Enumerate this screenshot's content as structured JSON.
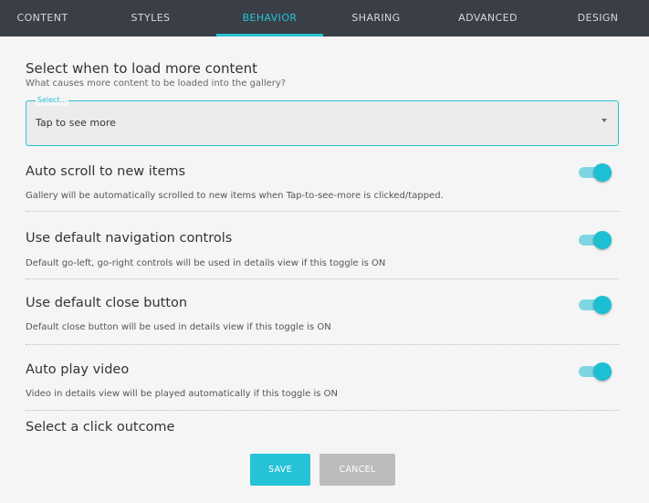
{
  "tabs": [
    {
      "label": "CONTENT",
      "active": false
    },
    {
      "label": "STYLES",
      "active": false
    },
    {
      "label": "BEHAVIOR",
      "active": true
    },
    {
      "label": "SHARING",
      "active": false
    },
    {
      "label": "ADVANCED",
      "active": false
    },
    {
      "label": "DESIGN",
      "active": false
    }
  ],
  "load_more": {
    "title": "Select when to load more content",
    "subtitle": "What causes more content to be loaded into the gallery?",
    "select_label": "Select...",
    "selected_value": "Tap to see more"
  },
  "toggles": [
    {
      "title": "Auto scroll to new items",
      "description": "Gallery will be automatically scrolled to new items when Tap-to-see-more is clicked/tapped.",
      "on": true
    },
    {
      "title": "Use default navigation controls",
      "description": "Default go-left, go-right controls will be used in details view if this toggle is ON",
      "on": true
    },
    {
      "title": "Use default close button",
      "description": "Default close button will be used in details view if this toggle is ON",
      "on": true
    },
    {
      "title": "Auto play video",
      "description": "Video in details view will be played automatically if this toggle is ON",
      "on": true
    }
  ],
  "click_outcome": {
    "title": "Select a click outcome"
  },
  "buttons": {
    "save_label": "SAVE",
    "cancel_label": "CANCEL"
  },
  "colors": {
    "accent": "#26c3d6",
    "topbar": "#3a3f47",
    "background": "#f5f5f5",
    "cancel": "#bcbcbc"
  }
}
